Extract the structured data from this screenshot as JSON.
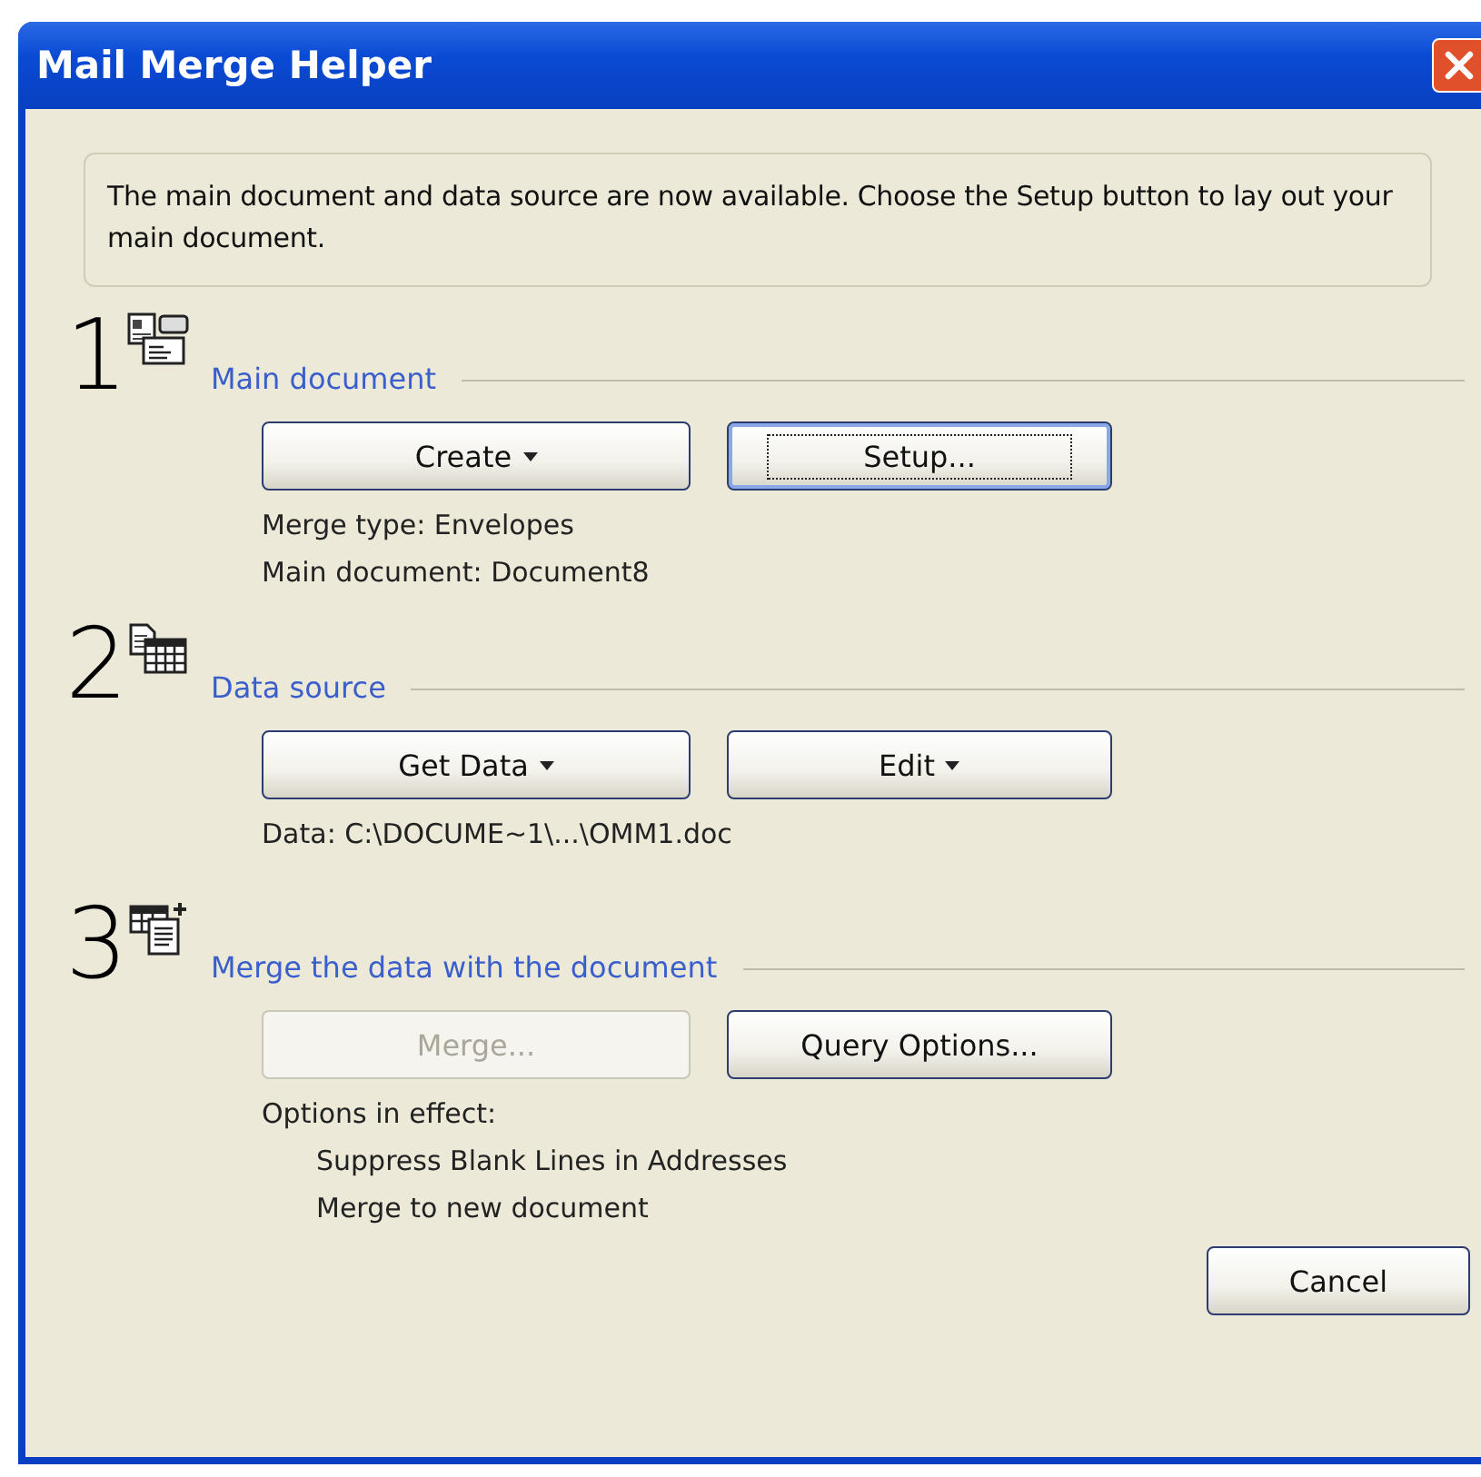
{
  "window": {
    "title": "Mail Merge Helper"
  },
  "intro": "The main document and data source are now available. Choose the Setup button to lay out your main document.",
  "steps": [
    {
      "number": "1",
      "heading": "Main document",
      "buttons": [
        {
          "label": "Create",
          "dropdown": true,
          "disabled": false,
          "focused": false
        },
        {
          "label": "Setup...",
          "dropdown": false,
          "disabled": false,
          "focused": true
        }
      ],
      "info": [
        {
          "text": "Merge type: Envelopes"
        },
        {
          "text": "Main document: Document8"
        }
      ]
    },
    {
      "number": "2",
      "heading": "Data source",
      "buttons": [
        {
          "label": "Get Data",
          "dropdown": true,
          "disabled": false,
          "focused": false
        },
        {
          "label": "Edit",
          "dropdown": true,
          "disabled": false,
          "focused": false
        }
      ],
      "info": [
        {
          "text": "Data: C:\\DOCUME~1\\...\\OMM1.doc"
        }
      ]
    },
    {
      "number": "3",
      "heading": "Merge the data with the document",
      "buttons": [
        {
          "label": "Merge...",
          "dropdown": false,
          "disabled": true,
          "focused": false
        },
        {
          "label": "Query Options...",
          "dropdown": false,
          "disabled": false,
          "focused": false
        }
      ],
      "info": [
        {
          "text": "Options in effect:",
          "children": [
            {
              "text": "Suppress Blank Lines in Addresses"
            },
            {
              "text": "Merge to new document"
            }
          ]
        }
      ]
    }
  ],
  "cancel_button": "Cancel"
}
